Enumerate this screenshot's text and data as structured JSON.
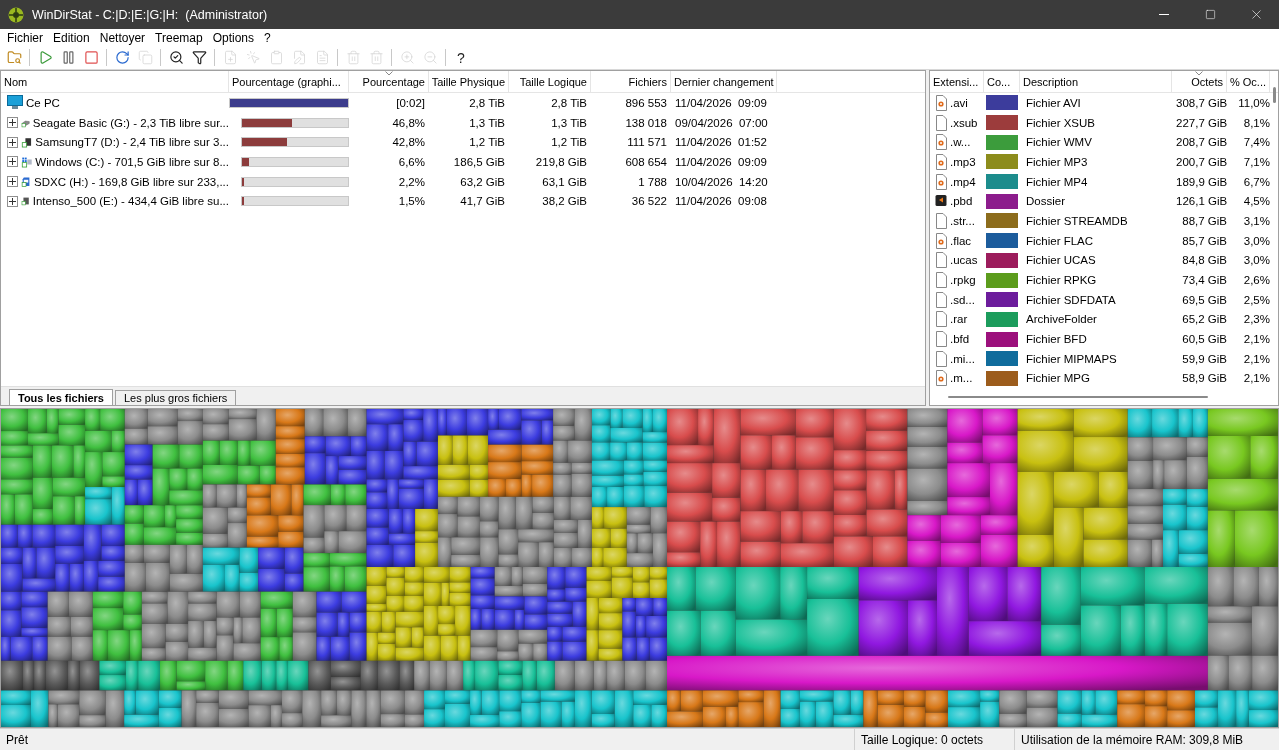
{
  "window": {
    "title": "WinDirStat - C:|D:|E:|G:|H:  (Administrator)"
  },
  "menu": [
    "Fichier",
    "Edition",
    "Nettoyer",
    "Treemap",
    "Options",
    "?"
  ],
  "toolbar": [
    {
      "kind": "open",
      "disabled": false
    },
    {
      "kind": "sep"
    },
    {
      "kind": "play",
      "disabled": false
    },
    {
      "kind": "pause",
      "disabled": false
    },
    {
      "kind": "stop",
      "disabled": false
    },
    {
      "kind": "sep"
    },
    {
      "kind": "refresh",
      "disabled": false
    },
    {
      "kind": "refresh-selected",
      "disabled": true
    },
    {
      "kind": "sep"
    },
    {
      "kind": "search",
      "disabled": false
    },
    {
      "kind": "filter",
      "disabled": false
    },
    {
      "kind": "sep"
    },
    {
      "kind": "new-file",
      "disabled": true
    },
    {
      "kind": "pointer",
      "disabled": true
    },
    {
      "kind": "paste",
      "disabled": true
    },
    {
      "kind": "edit",
      "disabled": true
    },
    {
      "kind": "info",
      "disabled": true
    },
    {
      "kind": "sep"
    },
    {
      "kind": "trash",
      "disabled": true
    },
    {
      "kind": "trash-red",
      "disabled": true
    },
    {
      "kind": "sep"
    },
    {
      "kind": "zoom-in",
      "disabled": true
    },
    {
      "kind": "zoom-out",
      "disabled": true
    },
    {
      "kind": "sep"
    },
    {
      "kind": "help",
      "label": "?",
      "disabled": false
    }
  ],
  "tree": {
    "columns": [
      {
        "label": "Nom",
        "sorted": false
      },
      {
        "label": "Pourcentage (graphi...",
        "sorted": false
      },
      {
        "label": "Pourcentage",
        "sorted": true
      },
      {
        "label": "Taille Physique",
        "sorted": false
      },
      {
        "label": "Taille Logique",
        "sorted": false
      },
      {
        "label": "Fichiers",
        "sorted": false
      },
      {
        "label": "Dernier changement",
        "sorted": false
      }
    ],
    "rows": [
      {
        "name": "Ce PC",
        "kind": "pc",
        "level": 1,
        "percent": "[0:02]",
        "physical": "2,8 TiB",
        "logical": "2,8 TiB",
        "files": "896 553",
        "modified": "11/04/2026  09:09",
        "children": [
          {
            "name": "Seagate Basic (G:) - 2,3 TiB libre sur...",
            "kind": "hdd",
            "expanded": false,
            "level": 0.468,
            "percent": "46,8%",
            "physical": "1,3 TiB",
            "logical": "1,3 TiB",
            "files": "138 018",
            "modified": "09/04/2026  07:00"
          },
          {
            "name": "SamsungT7 (D:) - 2,4 TiB libre sur 3...",
            "kind": "ssd",
            "expanded": false,
            "level": 0.428,
            "percent": "42,8%",
            "physical": "1,2 TiB",
            "logical": "1,2 TiB",
            "files": "111 571",
            "modified": "11/04/2026  01:52"
          },
          {
            "name": "Windows (C:) - 701,5 GiB libre sur 8...",
            "kind": "windows",
            "expanded": false,
            "level": 0.066,
            "percent": "6,6%",
            "physical": "186,5 GiB",
            "logical": "219,8 GiB",
            "files": "608 654",
            "modified": "11/04/2026  09:09"
          },
          {
            "name": "SDXC (H:) - 169,8 GiB libre sur 233,...",
            "kind": "sd",
            "expanded": false,
            "level": 0.022,
            "percent": "2,2%",
            "physical": "63,2 GiB",
            "logical": "63,1 GiB",
            "files": "1 788",
            "modified": "10/04/2026  14:20"
          },
          {
            "name": "Intenso_500 (E:) - 434,4 GiB libre su...",
            "kind": "usb",
            "expanded": false,
            "level": 0.015,
            "percent": "1,5%",
            "physical": "41,7 GiB",
            "logical": "38,2 GiB",
            "files": "36 522",
            "modified": "11/04/2026  09:08"
          }
        ]
      }
    ]
  },
  "tabs": [
    {
      "label": "Tous les fichiers",
      "selected": true
    },
    {
      "label": "Les plus gros fichiers",
      "selected": false
    }
  ],
  "extensions": {
    "columns": [
      {
        "label": "Extensi...",
        "sorted": false
      },
      {
        "label": "Co...",
        "sorted": false
      },
      {
        "label": "Description",
        "sorted": false
      },
      {
        "label": "Octets",
        "sorted": true
      },
      {
        "label": "% Oc...",
        "sorted": false
      }
    ],
    "rows": [
      {
        "kind": "media",
        "extension": ".avi",
        "color": "#3c3c9c",
        "description": "Fichier AVI",
        "bytes": "308,7 GiB",
        "percent": "11,0%"
      },
      {
        "kind": "file",
        "extension": ".xsub",
        "color": "#9c3c3c",
        "description": "Fichier XSUB",
        "bytes": "227,7 GiB",
        "percent": "8,1%"
      },
      {
        "kind": "media",
        "extension": ".w...",
        "color": "#3c9c3c",
        "description": "Fichier WMV",
        "bytes": "208,7 GiB",
        "percent": "7,4%"
      },
      {
        "kind": "media",
        "extension": ".mp3",
        "color": "#8c8c1c",
        "description": "Fichier MP3",
        "bytes": "200,7 GiB",
        "percent": "7,1%"
      },
      {
        "kind": "media",
        "extension": ".mp4",
        "color": "#1c8c8c",
        "description": "Fichier MP4",
        "bytes": "189,9 GiB",
        "percent": "6,7%"
      },
      {
        "kind": "app",
        "extension": ".pbd",
        "color": "#8c1c8c",
        "description": "Dossier",
        "bytes": "126,1 GiB",
        "percent": "4,5%"
      },
      {
        "kind": "file",
        "extension": ".str...",
        "color": "#8c6c1c",
        "description": "Fichier STREAMDB",
        "bytes": "88,7 GiB",
        "percent": "3,1%"
      },
      {
        "kind": "media",
        "extension": ".flac",
        "color": "#1c5c9c",
        "description": "Fichier FLAC",
        "bytes": "85,7 GiB",
        "percent": "3,0%"
      },
      {
        "kind": "file",
        "extension": ".ucas",
        "color": "#9c1c5c",
        "description": "Fichier UCAS",
        "bytes": "84,8 GiB",
        "percent": "3,0%"
      },
      {
        "kind": "file",
        "extension": ".rpkg",
        "color": "#5c9c1c",
        "description": "Fichier RPKG",
        "bytes": "73,4 GiB",
        "percent": "2,6%"
      },
      {
        "kind": "file",
        "extension": ".sd...",
        "color": "#6c1c9c",
        "description": "Fichier SDFDATA",
        "bytes": "69,5 GiB",
        "percent": "2,5%"
      },
      {
        "kind": "file",
        "extension": ".rar",
        "color": "#1c9c5c",
        "description": "ArchiveFolder",
        "bytes": "65,2 GiB",
        "percent": "2,3%"
      },
      {
        "kind": "file",
        "extension": ".bfd",
        "color": "#9c107c",
        "description": "Fichier BFD",
        "bytes": "60,5 GiB",
        "percent": "2,1%"
      },
      {
        "kind": "file",
        "extension": ".mi...",
        "color": "#106c9c",
        "description": "Fichier MIPMAPS",
        "bytes": "59,9 GiB",
        "percent": "2,1%"
      },
      {
        "kind": "media",
        "extension": ".m...",
        "color": "#9c5c1c",
        "description": "Fichier MPG",
        "bytes": "58,9 GiB",
        "percent": "2,1%"
      }
    ]
  },
  "status_bar": {
    "message": "Prêt",
    "logical_size": "Taille Logique: 0 octets",
    "memory": "Utilisation de la mémoire RAM: 309,8 MiB"
  }
}
